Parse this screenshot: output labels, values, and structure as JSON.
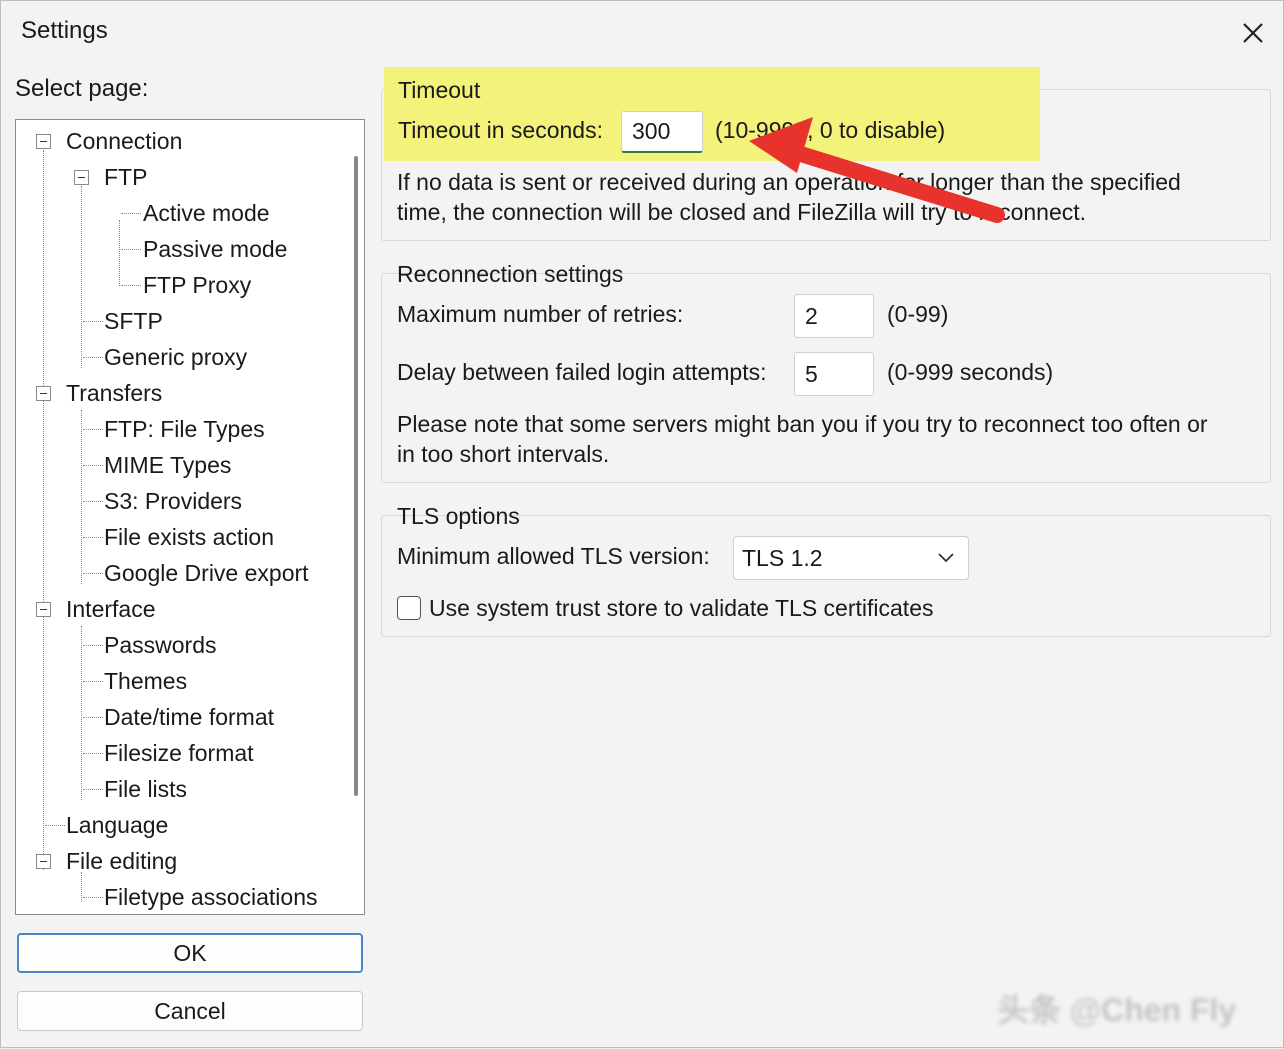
{
  "window": {
    "title": "Settings"
  },
  "nav": {
    "label": "Select page:",
    "items": [
      "Connection",
      "FTP",
      "Active mode",
      "Passive mode",
      "FTP Proxy",
      "SFTP",
      "Generic proxy",
      "Transfers",
      "FTP: File Types",
      "MIME Types",
      "S3: Providers",
      "File exists action",
      "Google Drive export",
      "Interface",
      "Passwords",
      "Themes",
      "Date/time format",
      "Filesize format",
      "File lists",
      "Language",
      "File editing",
      "Filetype associations"
    ]
  },
  "buttons": {
    "ok": "OK",
    "cancel": "Cancel"
  },
  "timeout": {
    "title": "Timeout",
    "label": "Timeout in seconds:",
    "value": "300",
    "range": "(10-9999, 0 to disable)",
    "desc_line1": "If no data is sent or received during an operation for longer than the specified",
    "desc_line2": "time, the connection will be closed and FileZilla will try to reconnect."
  },
  "reconnection": {
    "title": "Reconnection settings",
    "retries_label": "Maximum number of retries:",
    "retries_value": "2",
    "retries_range": "(0-99)",
    "delay_label": "Delay between failed login attempts:",
    "delay_value": "5",
    "delay_range": "(0-999 seconds)",
    "note_line1": "Please note that some servers might ban you if you try to reconnect too often or",
    "note_line2": "in too short intervals."
  },
  "tls": {
    "title": "TLS options",
    "min_label": "Minimum allowed TLS version:",
    "min_value": "TLS 1.2",
    "trust_label": "Use system trust store to validate TLS certificates"
  },
  "colors": {
    "highlight": "#f3f27a",
    "arrow": "#e8322c",
    "focus_underline": "#2f7d3a"
  }
}
